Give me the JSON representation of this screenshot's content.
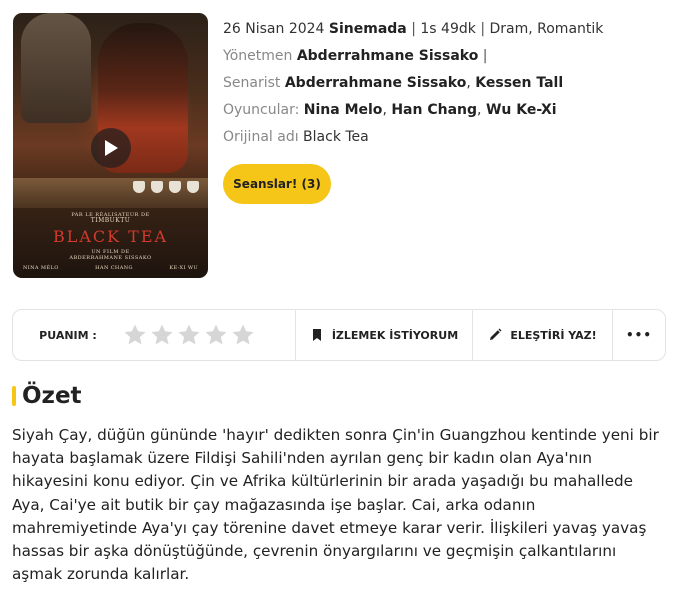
{
  "poster": {
    "kicker_line1": "PAR LE RÉALISATEUR DE",
    "kicker_line2": "TIMBUKTU",
    "title": "BLACK TEA",
    "film_by_line1": "UN FILM DE",
    "film_by_line2": "ABDERRAHMANE SISSAKO",
    "cast": [
      "NINA MÉLO",
      "HAN CHANG",
      "KE-XI WU"
    ]
  },
  "info": {
    "date": "26 Nisan 2024",
    "venue": "Sinemada",
    "duration": "1s 49dk",
    "genres": "Dram, Romantik",
    "director_label": "Yönetmen",
    "director": "Abderrahmane Sissako",
    "writer_label": "Senarist",
    "writers": [
      "Abderrahmane Sissako",
      "Kessen Tall"
    ],
    "cast_label": "Oyuncular:",
    "cast": [
      "Nina Melo",
      "Han Chang",
      "Wu Ke-Xi"
    ],
    "original_title_label": "Orijinal adı",
    "original_title": "Black Tea"
  },
  "showtimes_button": "Seanslar! (3)",
  "actions": {
    "rating_label": "PUANIM :",
    "stars_filled": 0,
    "stars_total": 5,
    "watchlist_label": "İZLEMEK İSTİYORUM",
    "review_label": "ELEŞTİRİ YAZ!",
    "more_label": "•••"
  },
  "summary": {
    "title": "Özet",
    "text": "Siyah Çay, düğün gününde 'hayır' dedikten sonra Çin'in Guangzhou kentinde yeni bir hayata başlamak üzere Fildişi Sahili'nden ayrılan genç bir kadın olan Aya'nın hikayesini konu ediyor. Çin ve Afrika kültürlerinin bir arada yaşadığı bu mahallede Aya, Cai'ye ait butik bir çay mağazasında işe başlar. Cai, arka odanın mahremiyetinde Aya'yı çay törenine davet etmeye karar verir. İlişkileri yavaş yavaş hassas bir aşka dönüştüğünde, çevrenin önyargılarını ve geçmişin çalkantılarını aşmak zorunda kalırlar."
  },
  "colors": {
    "accent": "#f5c518",
    "star_empty": "#d6d6d6",
    "poster_title": "#d13a2c"
  },
  "icons": {
    "play": "play-icon",
    "bookmark": "bookmark-icon",
    "pencil": "pencil-icon",
    "star": "star-icon"
  }
}
